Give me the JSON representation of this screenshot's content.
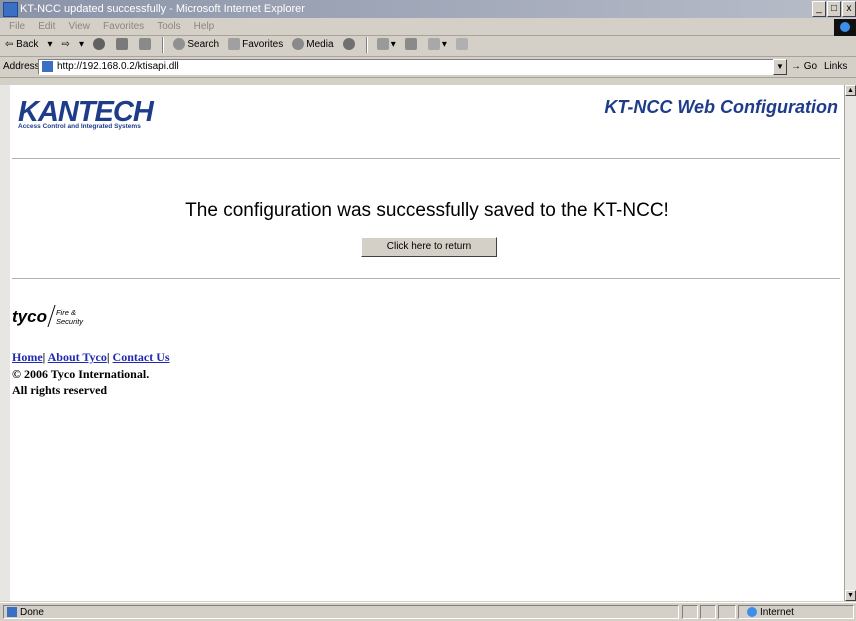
{
  "window": {
    "title": "KT-NCC updated successfully - Microsoft Internet Explorer",
    "buttons": {
      "minimize": "_",
      "maximize": "□",
      "close": "x"
    }
  },
  "menu": [
    "File",
    "Edit",
    "View",
    "Favorites",
    "Tools",
    "Help"
  ],
  "toolbar": {
    "back": "⇦ Back",
    "forward": "⇨",
    "search": "Search",
    "favorites": "Favorites",
    "media": "Media"
  },
  "address": {
    "label": "Address",
    "url": "http://192.168.0.2/ktisapi.dll",
    "go": "Go",
    "links": "Links"
  },
  "page": {
    "logo": "KANTECH",
    "logo_sub": "Access Control and Integrated Systems",
    "app_title": "KT-NCC Web Configuration",
    "message": "The configuration was successfully saved to the KT-NCC!",
    "return_button": "Click here to return",
    "tyco_word": "tyco",
    "tyco_sub_1": "Fire &",
    "tyco_sub_2": "Security",
    "links": {
      "home": "Home",
      "about": "About Tyco",
      "contact": "Contact Us"
    },
    "copyright": "© 2006 Tyco International.",
    "rights": "All rights reserved"
  },
  "status": {
    "text": "Done",
    "zone": "Internet"
  }
}
